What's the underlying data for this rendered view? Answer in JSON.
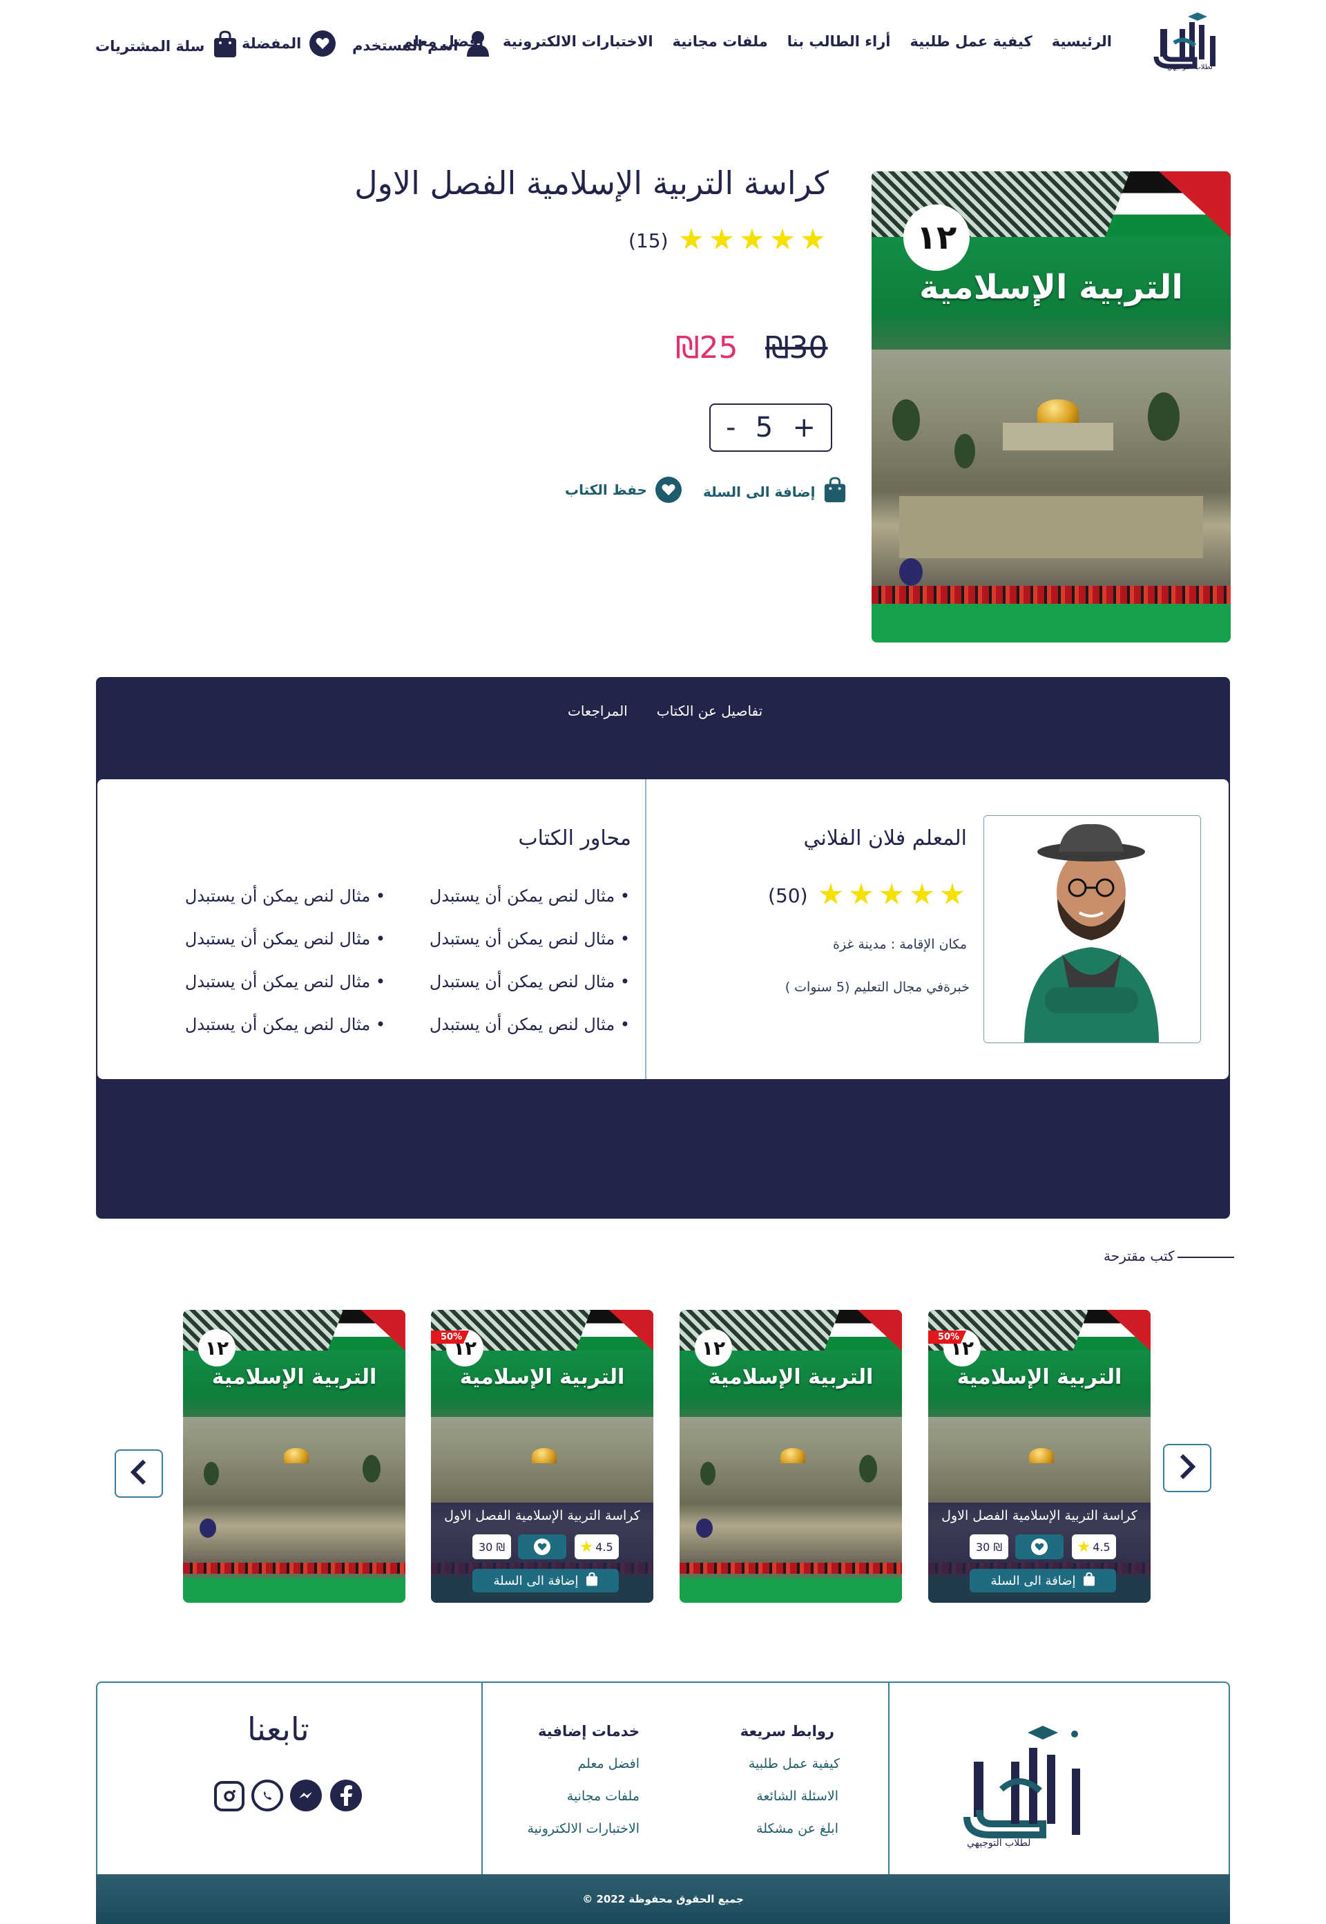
{
  "header": {
    "logo_text": "الأول",
    "logo_sub": "لطلاب التوجيهي",
    "nav": [
      "الرئيسية",
      "كيفية عمل طلبية",
      "أراء الطالب بنا",
      "ملفات مجانية",
      "الاختبارات الالكترونية",
      "افضل معلم"
    ],
    "user_label": "اسم المستخدم",
    "favorites_label": "المفضلة",
    "cart_label": "سلة المشتريات"
  },
  "product": {
    "title": "كراسة التربية الإسلامية الفصل الاول",
    "rating_count": "(15)",
    "rating": 5,
    "old_price": "₪30",
    "new_price": "₪25",
    "quantity": "5",
    "qty_minus": "-",
    "qty_plus": "+",
    "add_to_cart": "إضافة الى السلة",
    "save_book": "حفظ الكتاب",
    "cover_number": "١٢",
    "cover_title": "التربية الإسلامية"
  },
  "tabs": {
    "details": "تفاصيل عن الكتاب",
    "reviews": "المراجعات"
  },
  "teacher": {
    "name": "المعلم فلان الفلاني",
    "rating_count": "(50)",
    "rating": 5,
    "residence": "مكان الإقامة : مدينة غزة",
    "experience": "خبرةفي مجال التعليم (5 سنوات )"
  },
  "book_topics": {
    "heading": "محاور الكتاب",
    "col_right": [
      "مثال لنص يمكن أن يستبدل",
      "مثال لنص يمكن أن يستبدل",
      "مثال لنص يمكن أن يستبدل",
      "مثال لنص يمكن أن يستبدل"
    ],
    "col_left": [
      "مثال لنص يمكن أن يستبدل",
      "مثال لنص يمكن أن يستبدل",
      "مثال لنص يمكن أن يستبدل",
      "مثال لنص يمكن أن يستبدل"
    ]
  },
  "suggested": {
    "label": "كتب مقترحة",
    "items": [
      {
        "badge": "50%",
        "title": "كراسة التربية الإسلامية الفصل الاول",
        "rating": "4.5",
        "price": "30 ₪",
        "add": "إضافة الى السلة",
        "cover_number": "١٢",
        "cover_title": "التربية الإسلامية"
      },
      {
        "cover_number": "١٢",
        "cover_title": "التربية الإسلامية"
      },
      {
        "badge": "50%",
        "title": "كراسة التربية الإسلامية الفصل الاول",
        "rating": "4.5",
        "price": "30 ₪",
        "add": "إضافة الى السلة",
        "cover_number": "١٢",
        "cover_title": "التربية الإسلامية"
      },
      {
        "cover_number": "١٢",
        "cover_title": "التربية الإسلامية"
      }
    ]
  },
  "footer": {
    "quick_links_heading": "روابط سريعة",
    "quick_links": [
      "كيفية عمل طلبية",
      "الاسئلة الشائعة",
      "ابلغ عن مشكلة"
    ],
    "extra_heading": "خدمات إضافية",
    "extra_links": [
      "افضل معلم",
      "ملفات مجانية",
      "الاختبارات الالكترونية"
    ],
    "follow_us": "تابعنا",
    "copyright": "جميع الحقوق محفوظة 2022 ©",
    "social_icons": [
      "facebook-icon",
      "messenger-icon",
      "whatsapp-icon",
      "instagram-icon"
    ]
  },
  "colors": {
    "navy": "#23244a",
    "teal": "#1f6c82",
    "price_pink": "#e1306c",
    "star_yellow": "#f5e000"
  }
}
